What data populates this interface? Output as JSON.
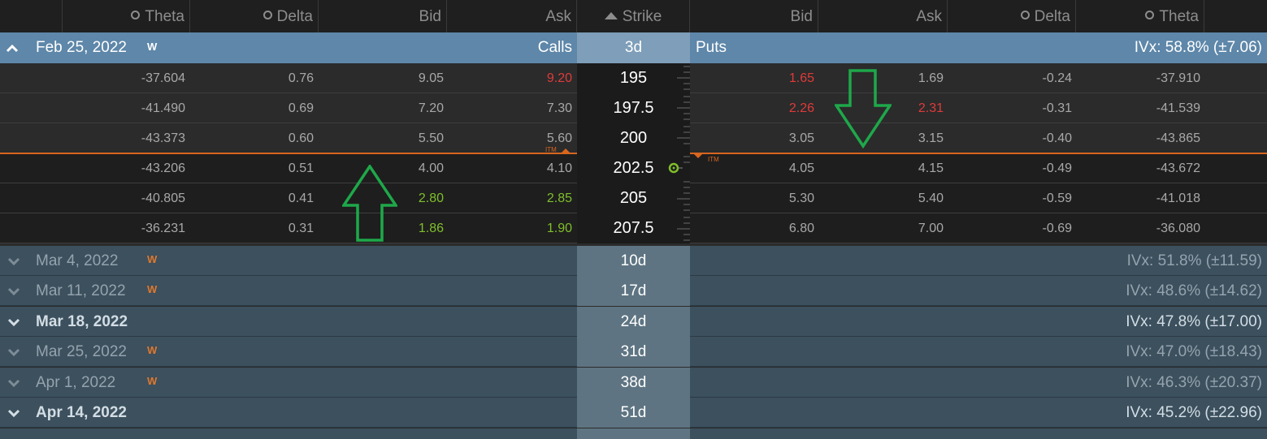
{
  "header": {
    "calls_columns": {
      "theta": "Theta",
      "delta": "Delta",
      "bid": "Bid",
      "ask": "Ask"
    },
    "strike": "Strike",
    "puts_columns": {
      "bid": "Bid",
      "ask": "Ask",
      "delta": "Delta",
      "theta": "Theta"
    }
  },
  "expanded_expiry": {
    "date": "Feb 25, 2022",
    "weekly_badge": "W",
    "calls_label": "Calls",
    "days": "3d",
    "puts_label": "Puts",
    "ivx": "IVx: 58.8% (±7.06)"
  },
  "itm_label": "ITM",
  "rows": [
    {
      "c_theta": "-37.604",
      "c_delta": "0.76",
      "c_bid": "9.05",
      "c_ask": "9.20",
      "strike": "195",
      "p_bid": "1.65",
      "p_ask": "1.69",
      "p_delta": "-0.24",
      "p_theta": "-37.910"
    },
    {
      "c_theta": "-41.490",
      "c_delta": "0.69",
      "c_bid": "7.20",
      "c_ask": "7.30",
      "strike": "197.5",
      "p_bid": "2.26",
      "p_ask": "2.31",
      "p_delta": "-0.31",
      "p_theta": "-41.539"
    },
    {
      "c_theta": "-43.373",
      "c_delta": "0.60",
      "c_bid": "5.50",
      "c_ask": "5.60",
      "strike": "200",
      "p_bid": "3.05",
      "p_ask": "3.15",
      "p_delta": "-0.40",
      "p_theta": "-43.865"
    },
    {
      "c_theta": "-43.206",
      "c_delta": "0.51",
      "c_bid": "4.00",
      "c_ask": "4.10",
      "strike": "202.5",
      "p_bid": "4.05",
      "p_ask": "4.15",
      "p_delta": "-0.49",
      "p_theta": "-43.672"
    },
    {
      "c_theta": "-40.805",
      "c_delta": "0.41",
      "c_bid": "2.80",
      "c_ask": "2.85",
      "strike": "205",
      "p_bid": "5.30",
      "p_ask": "5.40",
      "p_delta": "-0.59",
      "p_theta": "-41.018"
    },
    {
      "c_theta": "-36.231",
      "c_delta": "0.31",
      "c_bid": "1.86",
      "c_ask": "1.90",
      "strike": "207.5",
      "p_bid": "6.80",
      "p_ask": "7.00",
      "p_delta": "-0.69",
      "p_theta": "-36.080"
    }
  ],
  "expiries": [
    {
      "date": "Mar 4, 2022",
      "weekly": "W",
      "days": "10d",
      "ivx": "IVx: 51.8% (±11.59)"
    },
    {
      "date": "Mar 11, 2022",
      "weekly": "W",
      "days": "17d",
      "ivx": "IVx: 48.6% (±14.62)"
    },
    {
      "date": "Mar 18, 2022",
      "weekly": "",
      "days": "24d",
      "ivx": "IVx: 47.8% (±17.00)"
    },
    {
      "date": "Mar 25, 2022",
      "weekly": "W",
      "days": "31d",
      "ivx": "IVx: 47.0% (±18.43)"
    },
    {
      "date": "Apr 1, 2022",
      "weekly": "W",
      "days": "38d",
      "ivx": "IVx: 46.3% (±20.37)"
    },
    {
      "date": "Apr 14, 2022",
      "weekly": "",
      "days": "51d",
      "ivx": "IVx: 45.2% (±22.96)"
    }
  ],
  "colors": {
    "red": "#e03a3a",
    "green": "#7fbf2a",
    "annotation_green": "#1ea84a",
    "itm_orange": "#d9661f",
    "expiry_blue": "#5e87a9",
    "collapsed_row": "#3c505e"
  },
  "icons": [
    "chevron-up-icon",
    "chevron-down-icon",
    "sort-caret-icon",
    "radio-dot-icon",
    "target-marker-icon",
    "up-arrow-annotation",
    "down-arrow-annotation"
  ]
}
